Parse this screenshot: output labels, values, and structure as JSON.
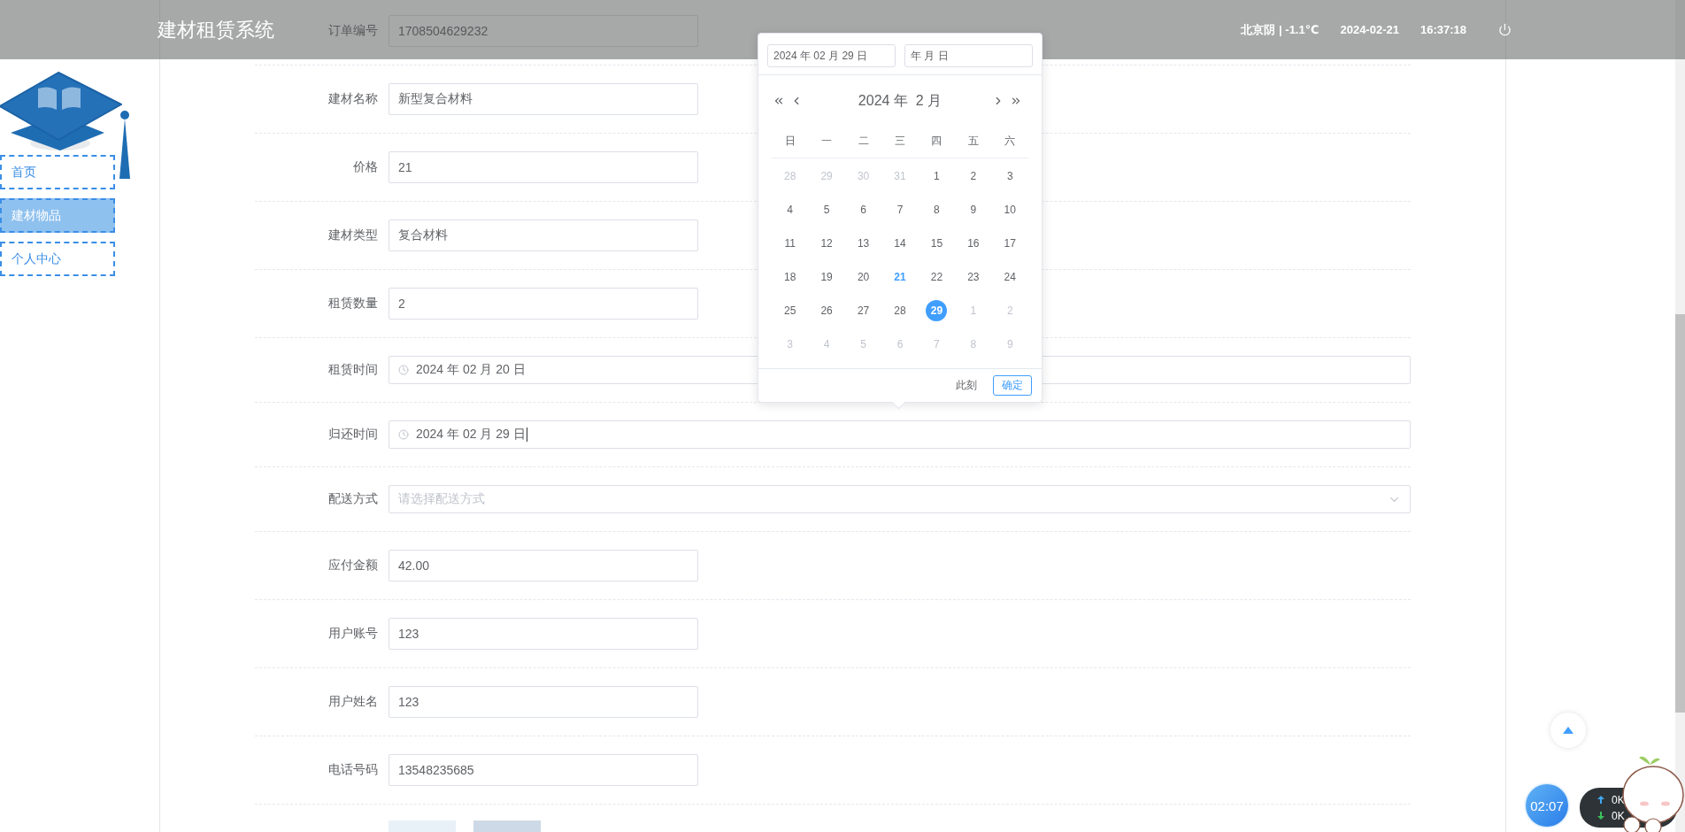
{
  "header": {
    "title": "建材租赁系统",
    "weather": "北京阴 | -1.1℃",
    "date": "2024-02-21",
    "time": "16:37:18"
  },
  "sidebar": {
    "items": [
      {
        "label": "首页",
        "selected": false
      },
      {
        "label": "建材物品",
        "selected": true
      },
      {
        "label": "个人中心",
        "selected": false
      }
    ]
  },
  "form": {
    "fields": [
      {
        "kind": "text",
        "label": "订单编号",
        "value": "1708504629232"
      },
      {
        "kind": "text",
        "label": "建材名称",
        "value": "新型复合材料"
      },
      {
        "kind": "text",
        "label": "价格",
        "value": "21"
      },
      {
        "kind": "text",
        "label": "建材类型",
        "value": "复合材料"
      },
      {
        "kind": "text",
        "label": "租赁数量",
        "value": "2"
      },
      {
        "kind": "date",
        "label": "租赁时间",
        "value": "2024 年 02 月 20 日",
        "focused": false
      },
      {
        "kind": "date",
        "label": "归还时间",
        "value": "2024 年 02 月 29 日",
        "focused": true
      },
      {
        "kind": "select",
        "label": "配送方式",
        "placeholder": "请选择配送方式"
      },
      {
        "kind": "text",
        "label": "应付金额",
        "value": "42.00"
      },
      {
        "kind": "text",
        "label": "用户账号",
        "value": "123"
      },
      {
        "kind": "text",
        "label": "用户姓名",
        "value": "123"
      },
      {
        "kind": "text",
        "label": "电话号码",
        "value": "13548235685"
      }
    ],
    "buttons": [
      {
        "kind": "light"
      },
      {
        "kind": "medium"
      }
    ]
  },
  "date_picker": {
    "start_value": "2024 年 02 月 29 日",
    "end_placeholder": "年 月 日",
    "month_title": "2024 年  2 月",
    "weekdays": [
      "日",
      "一",
      "二",
      "三",
      "四",
      "五",
      "六"
    ],
    "days": [
      {
        "text": "28",
        "muted": true,
        "today": false,
        "selected": false
      },
      {
        "text": "29",
        "muted": true,
        "today": false,
        "selected": false
      },
      {
        "text": "30",
        "muted": true,
        "today": false,
        "selected": false
      },
      {
        "text": "31",
        "muted": true,
        "today": false,
        "selected": false
      },
      {
        "text": "1",
        "muted": false,
        "today": false,
        "selected": false
      },
      {
        "text": "2",
        "muted": false,
        "today": false,
        "selected": false
      },
      {
        "text": "3",
        "muted": false,
        "today": false,
        "selected": false
      },
      {
        "text": "4",
        "muted": false,
        "today": false,
        "selected": false
      },
      {
        "text": "5",
        "muted": false,
        "today": false,
        "selected": false
      },
      {
        "text": "6",
        "muted": false,
        "today": false,
        "selected": false
      },
      {
        "text": "7",
        "muted": false,
        "today": false,
        "selected": false
      },
      {
        "text": "8",
        "muted": false,
        "today": false,
        "selected": false
      },
      {
        "text": "9",
        "muted": false,
        "today": false,
        "selected": false
      },
      {
        "text": "10",
        "muted": false,
        "today": false,
        "selected": false
      },
      {
        "text": "11",
        "muted": false,
        "today": false,
        "selected": false
      },
      {
        "text": "12",
        "muted": false,
        "today": false,
        "selected": false
      },
      {
        "text": "13",
        "muted": false,
        "today": false,
        "selected": false
      },
      {
        "text": "14",
        "muted": false,
        "today": false,
        "selected": false
      },
      {
        "text": "15",
        "muted": false,
        "today": false,
        "selected": false
      },
      {
        "text": "16",
        "muted": false,
        "today": false,
        "selected": false
      },
      {
        "text": "17",
        "muted": false,
        "today": false,
        "selected": false
      },
      {
        "text": "18",
        "muted": false,
        "today": false,
        "selected": false
      },
      {
        "text": "19",
        "muted": false,
        "today": false,
        "selected": false
      },
      {
        "text": "20",
        "muted": false,
        "today": false,
        "selected": false
      },
      {
        "text": "21",
        "muted": false,
        "today": true,
        "selected": false
      },
      {
        "text": "22",
        "muted": false,
        "today": false,
        "selected": false
      },
      {
        "text": "23",
        "muted": false,
        "today": false,
        "selected": false
      },
      {
        "text": "24",
        "muted": false,
        "today": false,
        "selected": false
      },
      {
        "text": "25",
        "muted": false,
        "today": false,
        "selected": false
      },
      {
        "text": "26",
        "muted": false,
        "today": false,
        "selected": false
      },
      {
        "text": "27",
        "muted": false,
        "today": false,
        "selected": false
      },
      {
        "text": "28",
        "muted": false,
        "today": false,
        "selected": false
      },
      {
        "text": "29",
        "muted": false,
        "today": false,
        "selected": true
      },
      {
        "text": "1",
        "muted": true,
        "today": false,
        "selected": false
      },
      {
        "text": "2",
        "muted": true,
        "today": false,
        "selected": false
      },
      {
        "text": "3",
        "muted": true,
        "today": false,
        "selected": false
      },
      {
        "text": "4",
        "muted": true,
        "today": false,
        "selected": false
      },
      {
        "text": "5",
        "muted": true,
        "today": false,
        "selected": false
      },
      {
        "text": "6",
        "muted": true,
        "today": false,
        "selected": false
      },
      {
        "text": "7",
        "muted": true,
        "today": false,
        "selected": false
      },
      {
        "text": "8",
        "muted": true,
        "today": false,
        "selected": false
      },
      {
        "text": "9",
        "muted": true,
        "today": false,
        "selected": false
      }
    ],
    "now_button": "此刻",
    "confirm_button": "确定"
  },
  "timer": "02:07",
  "speed_widget": {
    "upload": "0K",
    "download": "0K"
  }
}
